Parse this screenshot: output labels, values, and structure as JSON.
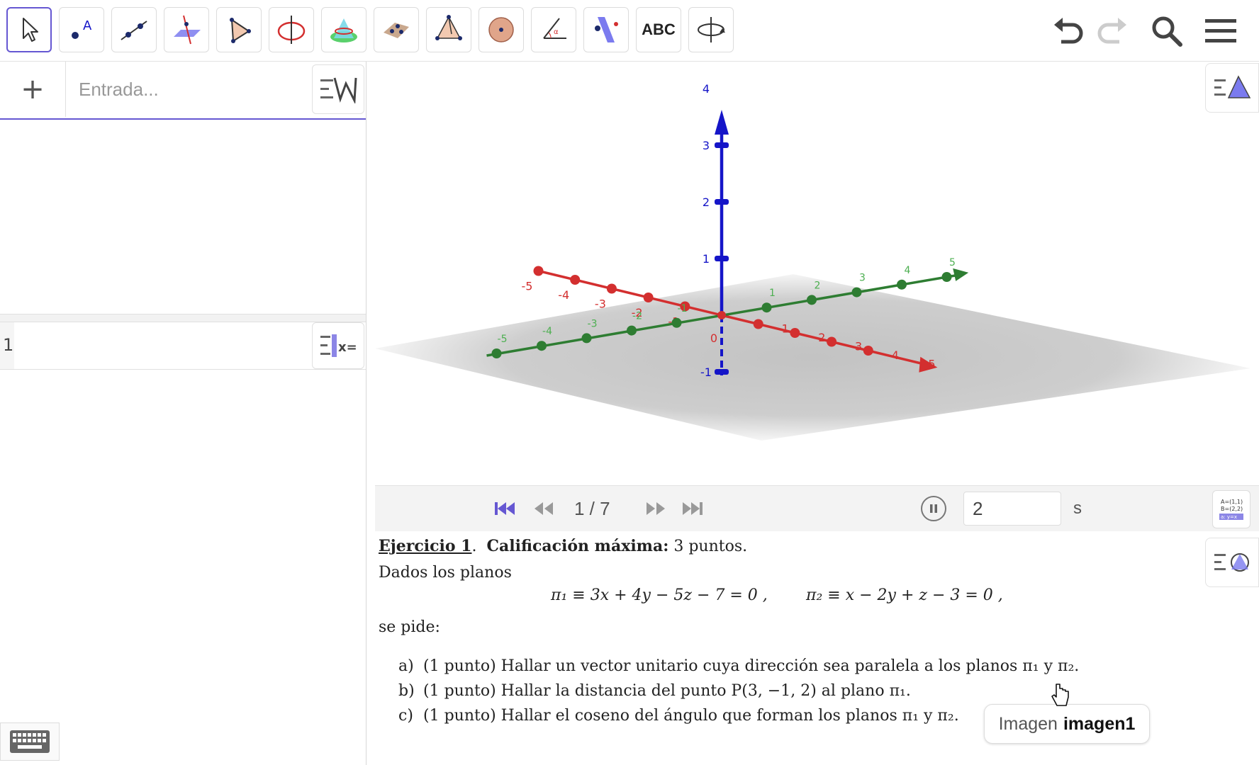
{
  "toolbar": {
    "tools": [
      {
        "name": "move-tool",
        "icon": "pointer-icon"
      },
      {
        "name": "point-tool",
        "icon": "point-icon"
      },
      {
        "name": "line-tool",
        "icon": "line-icon"
      },
      {
        "name": "perpendicular-line-tool",
        "icon": "perpendicular-line-icon"
      },
      {
        "name": "polygon-tool",
        "icon": "polygon-icon"
      },
      {
        "name": "circle-axis-tool",
        "icon": "circle-axis-icon"
      },
      {
        "name": "intersect-surfaces-tool",
        "icon": "intersect-surfaces-icon"
      },
      {
        "name": "plane-through-points-tool",
        "icon": "plane-points-icon"
      },
      {
        "name": "pyramid-tool",
        "icon": "pyramid-icon"
      },
      {
        "name": "sphere-tool",
        "icon": "sphere-icon"
      },
      {
        "name": "angle-tool",
        "icon": "angle-icon"
      },
      {
        "name": "reflect-tool",
        "icon": "reflect-icon"
      },
      {
        "name": "text-tool",
        "icon": "text-icon",
        "label": "ABC"
      },
      {
        "name": "rotate-view-tool",
        "icon": "rotate-view-icon"
      }
    ],
    "right": [
      "undo-icon",
      "redo-icon",
      "search-icon",
      "menu-icon"
    ]
  },
  "algebra": {
    "add_label": "+",
    "input_placeholder": "Entrada...",
    "row_number": "1"
  },
  "graphics3d": {
    "z_axis_labels": [
      "4",
      "3",
      "2",
      "1",
      "-1"
    ],
    "x_axis_labels": [
      "-5",
      "-4",
      "-3",
      "-2",
      "-1",
      "0",
      "1",
      "2",
      "3",
      "4",
      "5"
    ],
    "y_axis_labels": [
      "-5",
      "-4",
      "-3",
      "-2",
      "-1",
      "1",
      "2",
      "3",
      "4",
      "5"
    ],
    "origin_label": "0",
    "colors": {
      "x_axis": "#d32f2f",
      "y_axis": "#2e7d32",
      "z_axis": "#1515c8",
      "plane": "#bdbdbd",
      "accent": "#6557d2"
    }
  },
  "player": {
    "page_indicator": "1 / 7",
    "time_value": "2",
    "time_unit": "s"
  },
  "document": {
    "heading_ex": "Ejercicio 1",
    "heading_dot": ".",
    "heading_bold": "Calificación máxima:",
    "heading_points": "3 puntos.",
    "line_dados": "Dados los planos",
    "equation_1": "π₁ ≡ 3x + 4y − 5z − 7 = 0 ,",
    "equation_2": "π₂ ≡ x − 2y + z − 3 = 0 ,",
    "line_pide": "se pide:",
    "item_a_label": "a)",
    "item_a": "(1 punto) Hallar un vector unitario cuya dirección sea paralela a los planos π₁ y π₂.",
    "item_b_label": "b)",
    "item_b": "(1 punto) Hallar la distancia del punto P(3, −1, 2) al plano π₁.",
    "item_c_label": "c)",
    "item_c": "(1 punto) Hallar el coseno del ángulo que forman los planos π₁ y π₂."
  },
  "tooltip": {
    "prefix": "Imagen",
    "name": "imagen1"
  }
}
